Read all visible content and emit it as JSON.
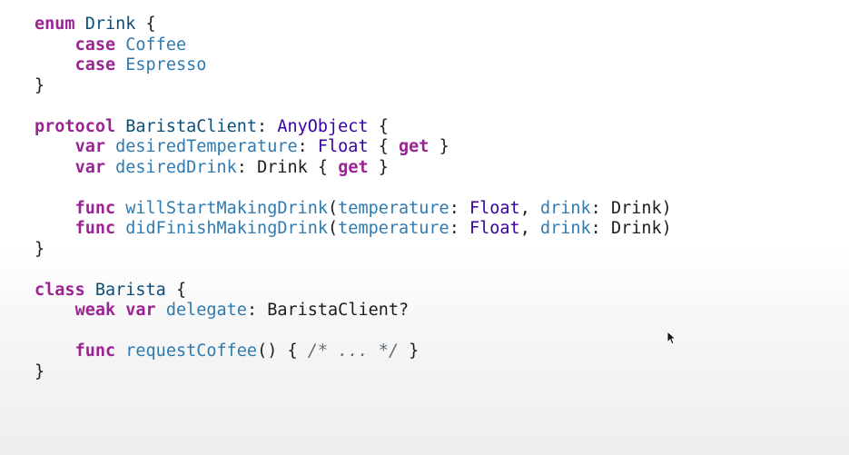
{
  "code": {
    "enum_kw": "enum",
    "enum_name": "Drink",
    "open_brace": "{",
    "close_brace": "}",
    "case_kw": "case",
    "case_coffee": "Coffee",
    "case_espresso": "Espresso",
    "protocol_kw": "protocol",
    "protocol_name": "BaristaClient",
    "colon": ":",
    "anyobject": "AnyObject",
    "var_kw": "var",
    "desired_temperature": "desiredTemperature",
    "float_type": "Float",
    "get_kw": "get",
    "desired_drink": "desiredDrink",
    "drink_type": "Drink",
    "func_kw": "func",
    "will_start": "willStartMakingDrink",
    "did_finish": "didFinishMakingDrink",
    "param_temperature": "temperature",
    "param_drink": "drink",
    "class_kw": "class",
    "class_name": "Barista",
    "weak_kw": "weak",
    "delegate_name": "delegate",
    "barista_client_optional": "BaristaClient?",
    "request_coffee": "requestCoffee",
    "empty_parens": "()",
    "comment": "/* ... */"
  },
  "colors": {
    "keyword": "#9b2393",
    "declared_type": "#0b4f79",
    "type_reference": "#3900a0",
    "member": "#2f7bb0",
    "plain": "#1d1d1d",
    "comment": "#5d6c79"
  },
  "cursor": {
    "icon": "mouse-pointer-icon"
  }
}
